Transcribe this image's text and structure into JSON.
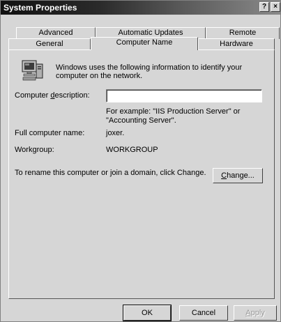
{
  "window": {
    "title": "System Properties",
    "help_button": "?",
    "close_button": "×"
  },
  "tabs": {
    "row1": [
      "Advanced",
      "Automatic Updates",
      "Remote"
    ],
    "row2": [
      "General",
      "Computer Name",
      "Hardware"
    ],
    "active": "Computer Name"
  },
  "content": {
    "intro": "Windows uses the following information to identify your computer on the network.",
    "description_label": "Computer description:",
    "description_value": "",
    "example_line1": "For example: \"IIS Production Server\" or",
    "example_line2": "\"Accounting Server\".",
    "full_name_label": "Full computer name:",
    "full_name_value": "joxer.",
    "workgroup_label": "Workgroup:",
    "workgroup_value": "WORKGROUP",
    "rename_text": "To rename this computer or join a domain, click Change.",
    "change_button": "Change..."
  },
  "footer": {
    "ok": "OK",
    "cancel": "Cancel",
    "apply": "Apply"
  },
  "icons": {
    "computer": "computer-icon"
  }
}
